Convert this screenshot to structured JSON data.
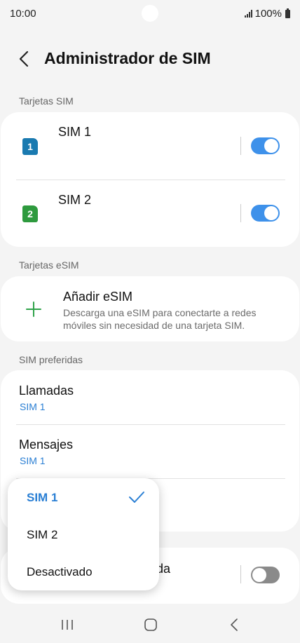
{
  "status": {
    "time": "10:00",
    "battery": "100%"
  },
  "header": {
    "title": "Administrador de SIM"
  },
  "sections": {
    "sim_cards": "Tarjetas SIM",
    "esim_cards": "Tarjetas eSIM",
    "preferred": "SIM preferidas"
  },
  "sim_cards": [
    {
      "badge": "1",
      "name": "SIM 1",
      "enabled": true,
      "color": "#1a7ab0"
    },
    {
      "badge": "2",
      "name": "SIM 2",
      "enabled": true,
      "color": "#2e9a3e"
    }
  ],
  "esim": {
    "title": "Añadir eSIM",
    "description": "Descarga una eSIM para conectarte a redes móviles sin necesidad de una tarjeta SIM."
  },
  "preferred": {
    "calls": {
      "title": "Llamadas",
      "value": "SIM 1"
    },
    "messages": {
      "title": "Mensajes",
      "value": "SIM 1"
    }
  },
  "partial_row": {
    "title_fragment": "da",
    "enabled": false
  },
  "popup": {
    "options": [
      {
        "label": "SIM 1",
        "selected": true
      },
      {
        "label": "SIM 2",
        "selected": false
      },
      {
        "label": "Desactivado",
        "selected": false
      }
    ]
  },
  "colors": {
    "accent": "#3e91ea",
    "link": "#2a7fd4",
    "background": "#f4f4f4"
  },
  "icons": {
    "back": "back-arrow-icon",
    "add": "plus-icon",
    "check": "check-icon",
    "nav_recents": "recents-icon",
    "nav_home": "home-icon",
    "nav_back": "nav-back-icon"
  }
}
